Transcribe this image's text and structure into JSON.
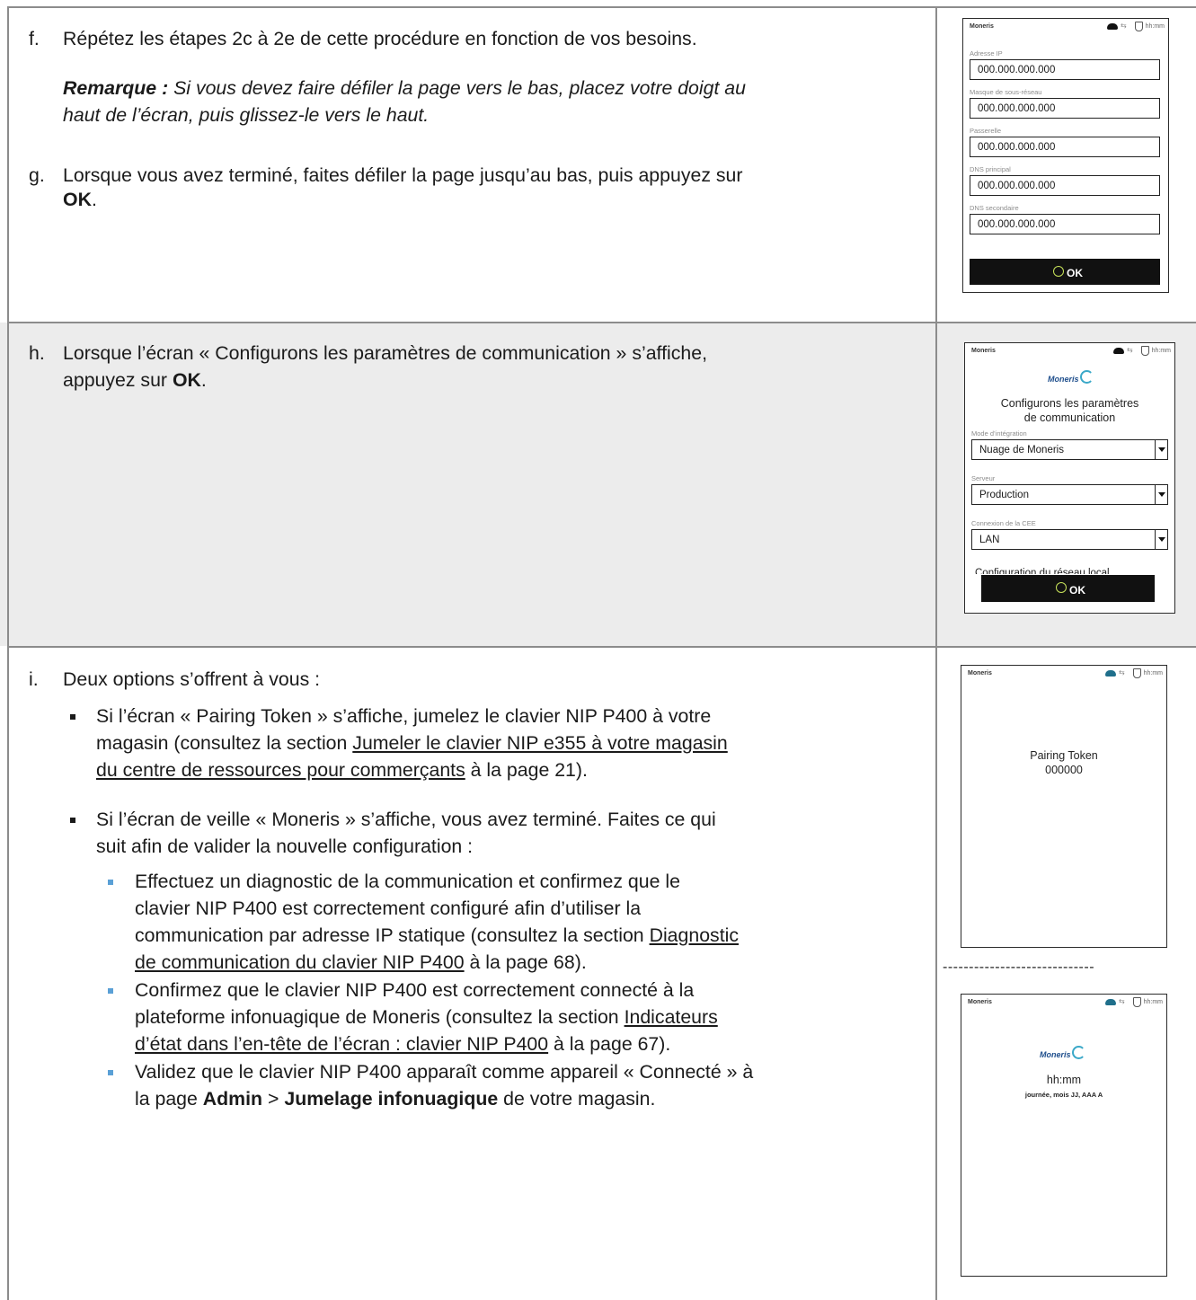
{
  "steps": {
    "f": {
      "letter": "f.",
      "line1": "Répétez les étapes 2c à 2e de cette procédure en fonction de vos besoins.",
      "note_label": "Remarque :",
      "note_line1": " Si vous devez faire défiler la page vers le bas, placez votre doigt au",
      "note_line2": "haut de l’écran, puis glissez-le vers le haut."
    },
    "g": {
      "letter": "g.",
      "line1": "Lorsque vous avez terminé, faites défiler la page jusqu’au bas, puis appuyez sur",
      "ok": "OK",
      "end": "."
    },
    "h": {
      "letter": "h.",
      "line1": "Lorsque l’écran « Configurons les paramètres de communication » s’affiche,",
      "line2_pre": "appuyez sur ",
      "ok": "OK",
      "end": "."
    },
    "i": {
      "letter": "i.",
      "intro": "Deux options s’offrent à vous :",
      "b1_line1": "Si l’écran « Pairing Token » s’affiche, jumelez le clavier NIP P400 à votre",
      "b1_line2_pre": "magasin (consultez la section ",
      "b1_link_part1": "Jumeler le clavier NIP e355 à votre magasin",
      "b1_link_part2": "du centre de ressources pour commerçants",
      "b1_line3_post": " à la page 21).",
      "b2_line1": "Si l’écran de veille « Moneris » s’affiche, vous avez terminé. Faites ce qui",
      "b2_line2": "suit afin de valider la nouvelle configuration :",
      "s1_line1": "Effectuez un diagnostic de la communication et confirmez que le",
      "s1_line2": "clavier NIP P400 est correctement configuré afin d’utiliser la",
      "s1_line3_pre": "communication par adresse IP statique (consultez la section ",
      "s1_link1": "Diagnostic",
      "s1_link2": "de communication du clavier NIP P400",
      "s1_line4_post": " à la page 68).",
      "s2_line1": "Confirmez que le clavier NIP P400 est correctement connecté à la",
      "s2_line2_pre": "plateforme infonuagique de Moneris (consultez la section ",
      "s2_link1": "Indicateurs",
      "s2_link2": "d’état dans l’en-tête de l’écran : clavier NIP P400",
      "s2_line3_post": " à la page 67).",
      "s3_line1": "Validez que le clavier NIP P400 apparaît comme appareil « Connecté » à",
      "s3_line2_pre": "la page ",
      "s3_admin": "Admin",
      "s3_sep": " > ",
      "s3_jum": "Jumelage infonuagique",
      "s3_line2_post": " de votre magasin."
    }
  },
  "devices": {
    "header": {
      "brand": "Moneris",
      "time": "hh:mm",
      "arrows": "⇆"
    },
    "network": {
      "fields": [
        {
          "label": "Adresse IP",
          "value": "000.000.000.000"
        },
        {
          "label": "Masque de sous-réseau",
          "value": "000.000.000.000"
        },
        {
          "label": "Passerelle",
          "value": "000.000.000.000"
        },
        {
          "label": "DNS principal",
          "value": "000.000.000.000"
        },
        {
          "label": "DNS secondaire",
          "value": "000.000.000.000"
        }
      ],
      "ok": "OK"
    },
    "config": {
      "logo": "Moneris",
      "title_line1": "Configurons les paramètres",
      "title_line2": "de communication",
      "fields": [
        {
          "label": "Mode d’intégration",
          "value": "Nuage de Moneris"
        },
        {
          "label": "Serveur",
          "value": "Production"
        },
        {
          "label": "Connexion de la CEE",
          "value": "LAN"
        }
      ],
      "cut_text": "Configuration du réseau local",
      "ok": "OK"
    },
    "pairing": {
      "title": "Pairing Token",
      "code": "000000"
    },
    "separator": "-----------------------------",
    "idle": {
      "logo": "Moneris",
      "time": "hh:mm",
      "date": "journée, mois JJ, AAA A"
    }
  }
}
